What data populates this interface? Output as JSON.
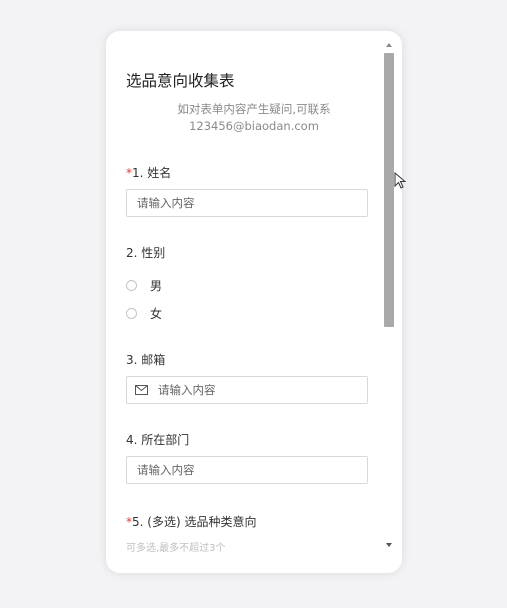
{
  "form": {
    "title": "选品意向收集表",
    "description_line1": "如对表单内容产生疑问,可联系",
    "description_line2": "123456@biaodan.com"
  },
  "questions": {
    "q1": {
      "required_mark": "*",
      "label": "1. 姓名",
      "placeholder": "请输入内容"
    },
    "q2": {
      "label": "2. 性别",
      "options": [
        "男",
        "女"
      ]
    },
    "q3": {
      "label": "3. 邮箱",
      "placeholder": "请输入内容",
      "icon": "mail-icon"
    },
    "q4": {
      "label": "4. 所在部门",
      "placeholder": "请输入内容"
    },
    "q5": {
      "required_mark": "*",
      "label": "5. (多选) 选品种类意向",
      "hint": "可多选,最多不超过3个"
    }
  },
  "colors": {
    "required": "#e53935",
    "scrollbar_thumb": "#a9a9a9"
  }
}
